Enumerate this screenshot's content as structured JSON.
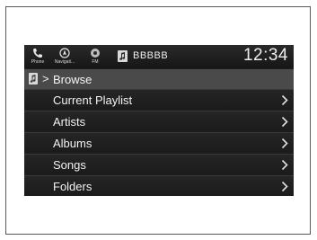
{
  "status_bar": {
    "items": [
      {
        "label": "Phone",
        "icon": "phone-icon"
      },
      {
        "label": "Navigati...",
        "icon": "navigation-icon"
      },
      {
        "label": "FM",
        "icon": "fm-radio-icon"
      }
    ],
    "source_icon": "music-note-icon",
    "source_name": "BBBBB",
    "clock": "12:34"
  },
  "breadcrumb": {
    "icon": "music-note-icon",
    "separator": ">",
    "label": "Browse"
  },
  "menu": {
    "items": [
      {
        "label": "Current Playlist"
      },
      {
        "label": "Artists"
      },
      {
        "label": "Albums"
      },
      {
        "label": "Songs"
      },
      {
        "label": "Folders"
      }
    ]
  },
  "colors": {
    "screen_bg": "#1d1d1d",
    "breadcrumb_bg": "#4a4a4a",
    "text": "#f2f2f2"
  }
}
